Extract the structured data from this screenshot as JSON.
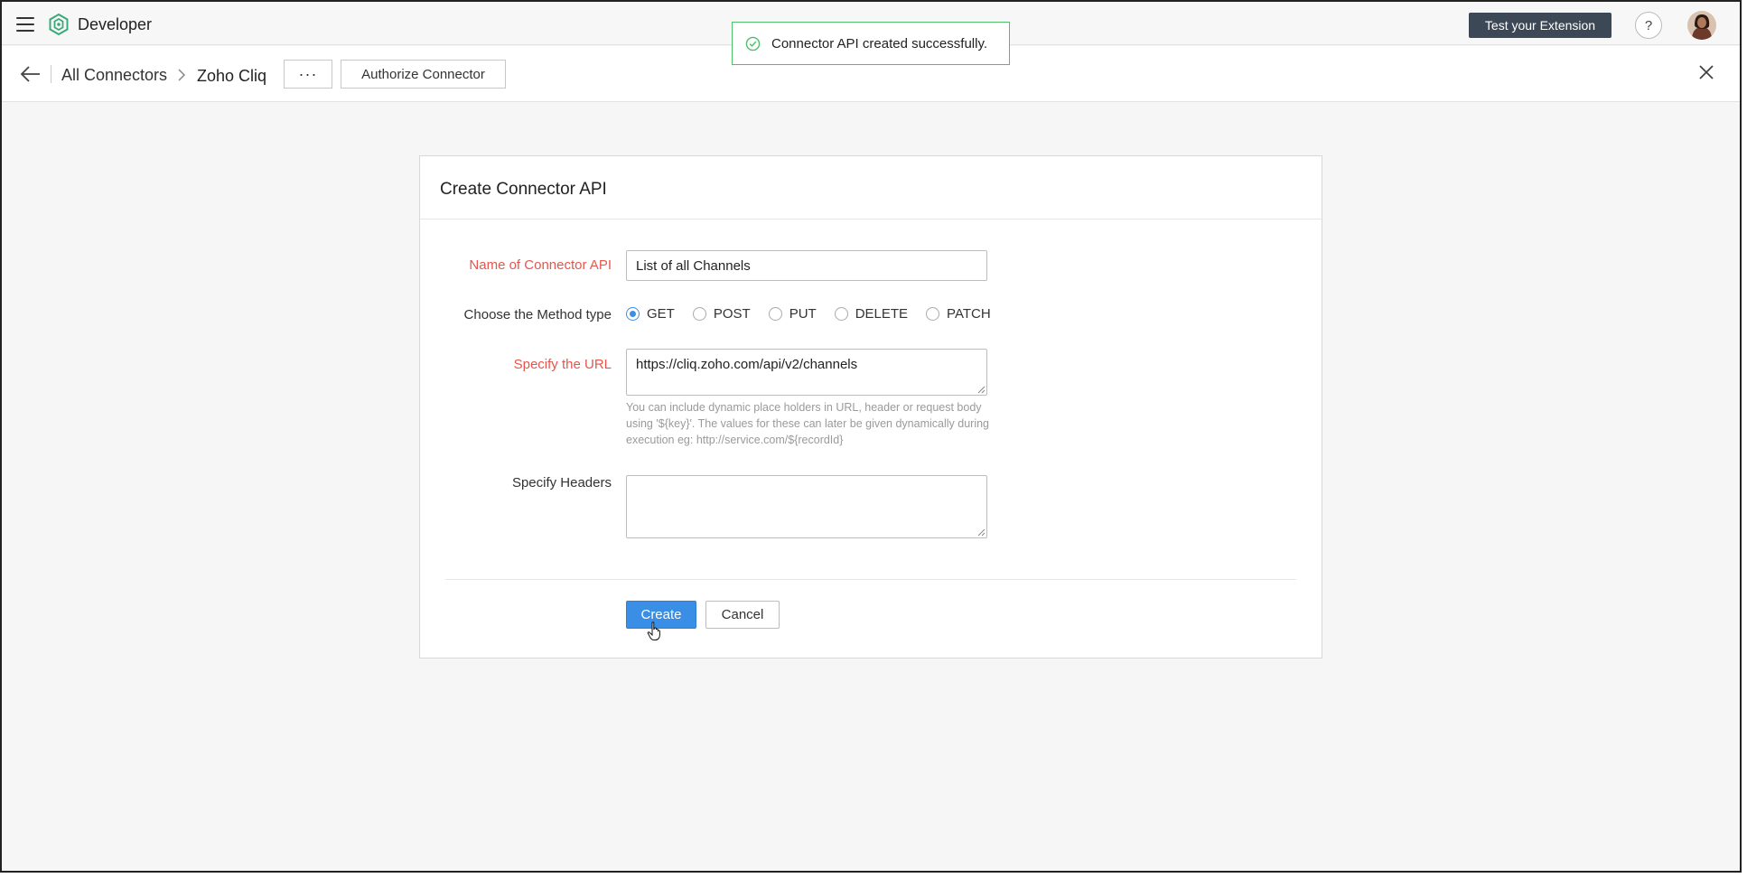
{
  "app": {
    "name": "Developer"
  },
  "toast": {
    "message": "Connector API created successfully."
  },
  "header": {
    "test_extension_label": "Test your Extension",
    "help_label": "?"
  },
  "breadcrumb": {
    "root": "All Connectors",
    "current": "Zoho Cliq"
  },
  "toolbar": {
    "more_label": "···",
    "authorize_label": "Authorize Connector"
  },
  "form": {
    "title": "Create Connector API",
    "name_label": "Name of Connector API",
    "name_value": "List of all Channels",
    "method_label": "Choose the Method type",
    "methods": [
      "GET",
      "POST",
      "PUT",
      "DELETE",
      "PATCH"
    ],
    "selected_method": "GET",
    "url_label": "Specify the URL",
    "url_value": "https://cliq.zoho.com/api/v2/channels",
    "url_hint": "You can include dynamic place holders in URL, header or request body using '${key}'. The values for these can later be given dynamically during execution eg: http://service.com/${recordId}",
    "headers_label": "Specify Headers",
    "headers_value": "",
    "create_label": "Create",
    "cancel_label": "Cancel"
  },
  "colors": {
    "accent": "#3a8ee6",
    "required_label": "#e5564d",
    "success_border": "#4cc06a",
    "dark_button": "#3d4857"
  }
}
